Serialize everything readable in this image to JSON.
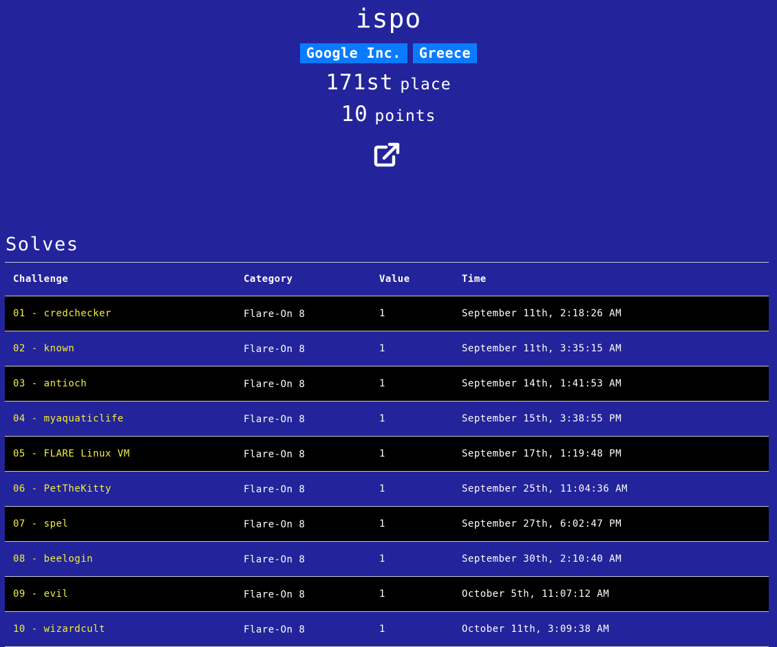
{
  "user": {
    "name": "ispo",
    "badges": [
      "Google Inc.",
      "Greece"
    ],
    "place_value": "171st",
    "place_label": "place",
    "points_value": "10",
    "points_label": "points",
    "link_icon": "external-link-icon"
  },
  "solves": {
    "title": "Solves",
    "columns": [
      "Challenge",
      "Category",
      "Value",
      "Time"
    ],
    "rows": [
      {
        "challenge": "01 - credchecker",
        "category": "Flare-On 8",
        "value": "1",
        "time": "September 11th, 2:18:26 AM"
      },
      {
        "challenge": "02 - known",
        "category": "Flare-On 8",
        "value": "1",
        "time": "September 11th, 3:35:15 AM"
      },
      {
        "challenge": "03 - antioch",
        "category": "Flare-On 8",
        "value": "1",
        "time": "September 14th, 1:41:53 AM"
      },
      {
        "challenge": "04 - myaquaticlife",
        "category": "Flare-On 8",
        "value": "1",
        "time": "September 15th, 3:38:55 PM"
      },
      {
        "challenge": "05 - FLARE Linux VM",
        "category": "Flare-On 8",
        "value": "1",
        "time": "September 17th, 1:19:48 PM"
      },
      {
        "challenge": "06 - PetTheKitty",
        "category": "Flare-On 8",
        "value": "1",
        "time": "September 25th, 11:04:36 AM"
      },
      {
        "challenge": "07 - spel",
        "category": "Flare-On 8",
        "value": "1",
        "time": "September 27th, 6:02:47 PM"
      },
      {
        "challenge": "08 - beelogin",
        "category": "Flare-On 8",
        "value": "1",
        "time": "September 30th, 2:10:40 AM"
      },
      {
        "challenge": "09 - evil",
        "category": "Flare-On 8",
        "value": "1",
        "time": "October 5th, 11:07:12 AM"
      },
      {
        "challenge": "10 - wizardcult",
        "category": "Flare-On 8",
        "value": "1",
        "time": "October 11th, 3:09:38 AM"
      }
    ]
  },
  "colors": {
    "background": "#23239b",
    "badge": "#0a7bff",
    "challenge_link": "#f2f03a",
    "row_alt": "#000000"
  }
}
